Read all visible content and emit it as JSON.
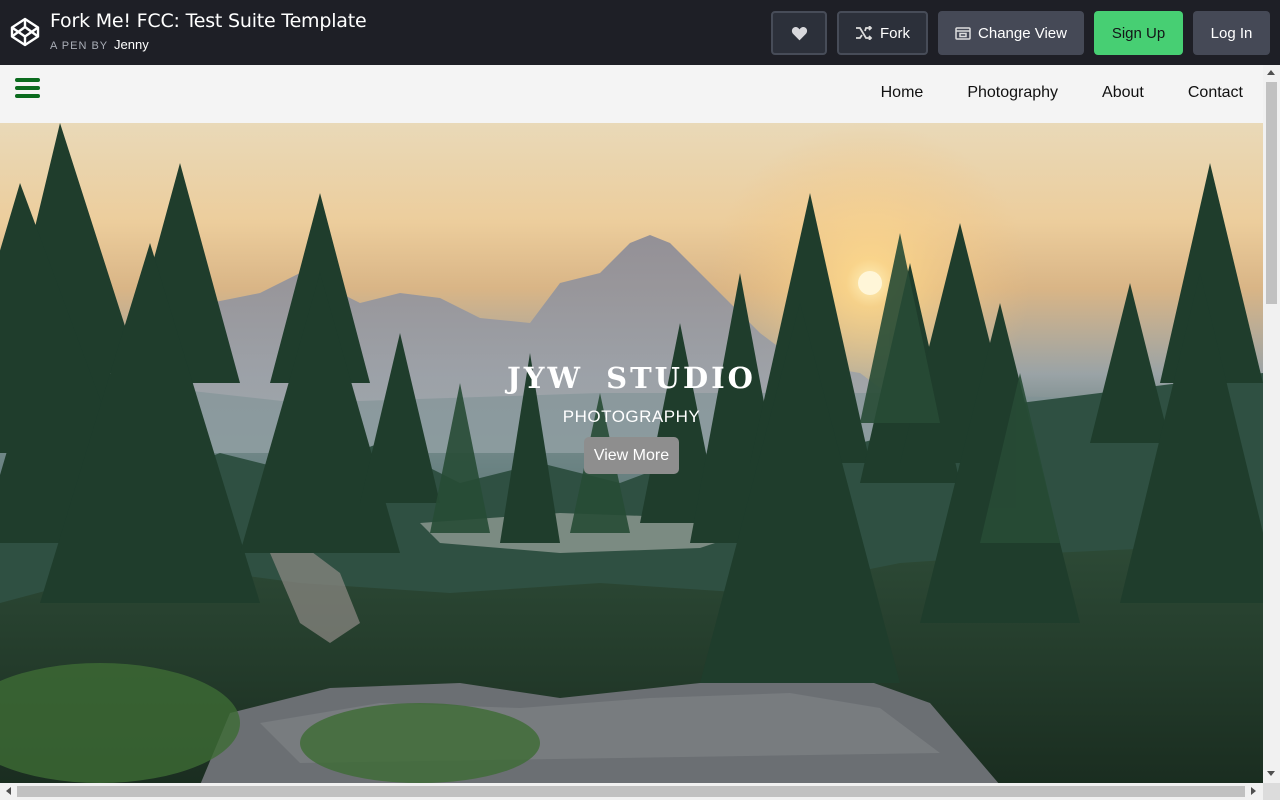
{
  "codepen": {
    "title": "Fork Me! FCC: Test Suite Template",
    "by_label": "A PEN BY",
    "author": "Jenny",
    "buttons": {
      "fork": "Fork",
      "change_view": "Change View",
      "sign_up": "Sign Up",
      "log_in": "Log In"
    },
    "icons": {
      "logo": "codepen-logo-icon",
      "heart": "heart-icon",
      "fork": "fork-icon",
      "change_view": "change-view-icon"
    }
  },
  "site": {
    "nav": {
      "menu_icon": "hamburger-menu-icon",
      "links": [
        "Home",
        "Photography",
        "About",
        "Contact"
      ]
    },
    "hero": {
      "title": "JYW STUDIO",
      "subtitle": "PHOTOGRAPHY",
      "button": "View More"
    }
  },
  "colors": {
    "header_bg": "#1e1f26",
    "signup_green": "#47cf73",
    "hamburger_green": "#0b6b1e",
    "nav_bg": "#f4f4f4",
    "view_more_bg": "#8e8e8e"
  }
}
